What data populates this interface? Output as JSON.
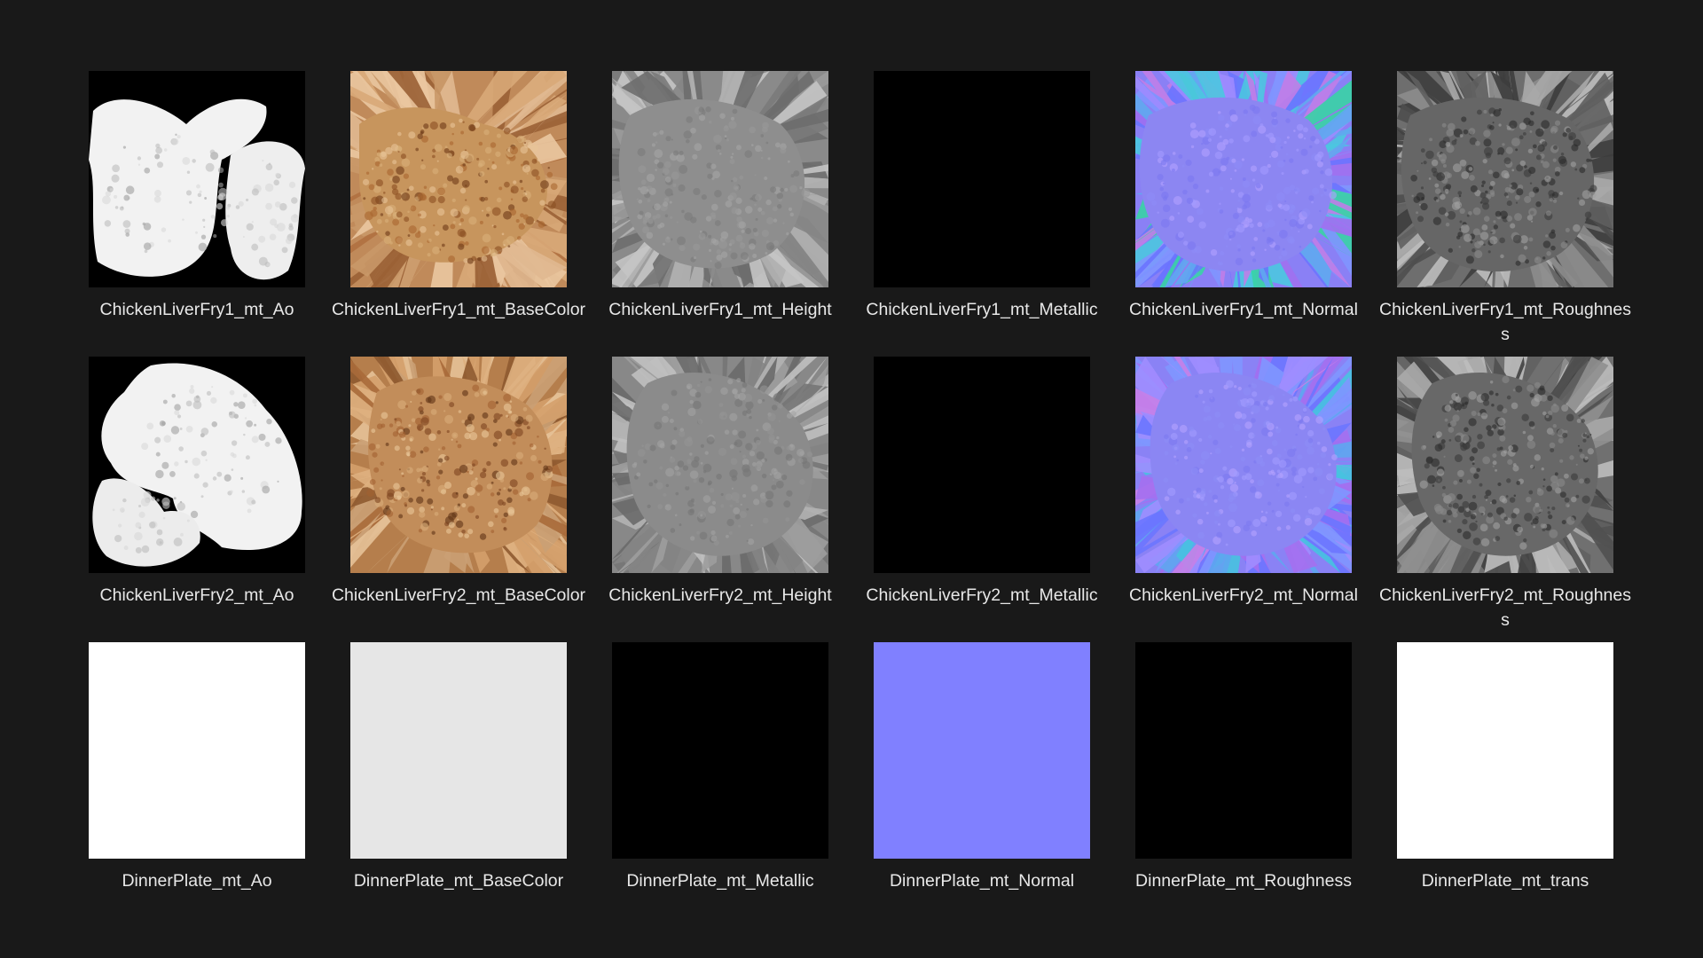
{
  "files": [
    {
      "label": "ChickenLiverFry1_mt_Ao",
      "kind": "ao1"
    },
    {
      "label": "ChickenLiverFry1_mt_BaseColor",
      "kind": "base1"
    },
    {
      "label": "ChickenLiverFry1_mt_Height",
      "kind": "height1"
    },
    {
      "label": "ChickenLiverFry1_mt_Metallic",
      "kind": "black"
    },
    {
      "label": "ChickenLiverFry1_mt_Normal",
      "kind": "normal1"
    },
    {
      "label": "ChickenLiverFry1_mt_Roughness",
      "kind": "rough1"
    },
    {
      "label": "ChickenLiverFry2_mt_Ao",
      "kind": "ao2"
    },
    {
      "label": "ChickenLiverFry2_mt_BaseColor",
      "kind": "base2"
    },
    {
      "label": "ChickenLiverFry2_mt_Height",
      "kind": "height2"
    },
    {
      "label": "ChickenLiverFry2_mt_Metallic",
      "kind": "black"
    },
    {
      "label": "ChickenLiverFry2_mt_Normal",
      "kind": "normal2"
    },
    {
      "label": "ChickenLiverFry2_mt_Roughness",
      "kind": "rough2"
    },
    {
      "label": "DinnerPlate_mt_Ao",
      "kind": "white"
    },
    {
      "label": "DinnerPlate_mt_BaseColor",
      "kind": "lightgray"
    },
    {
      "label": "DinnerPlate_mt_Metallic",
      "kind": "black"
    },
    {
      "label": "DinnerPlate_mt_Normal",
      "kind": "flatnormal"
    },
    {
      "label": "DinnerPlate_mt_Roughness",
      "kind": "black"
    },
    {
      "label": "DinnerPlate_mt_trans",
      "kind": "white"
    }
  ],
  "colors": {
    "background": "#191919",
    "text": "#e8e8e8",
    "flat_normal": "#8080ff",
    "plate_basecolor": "#e6e6e6"
  }
}
